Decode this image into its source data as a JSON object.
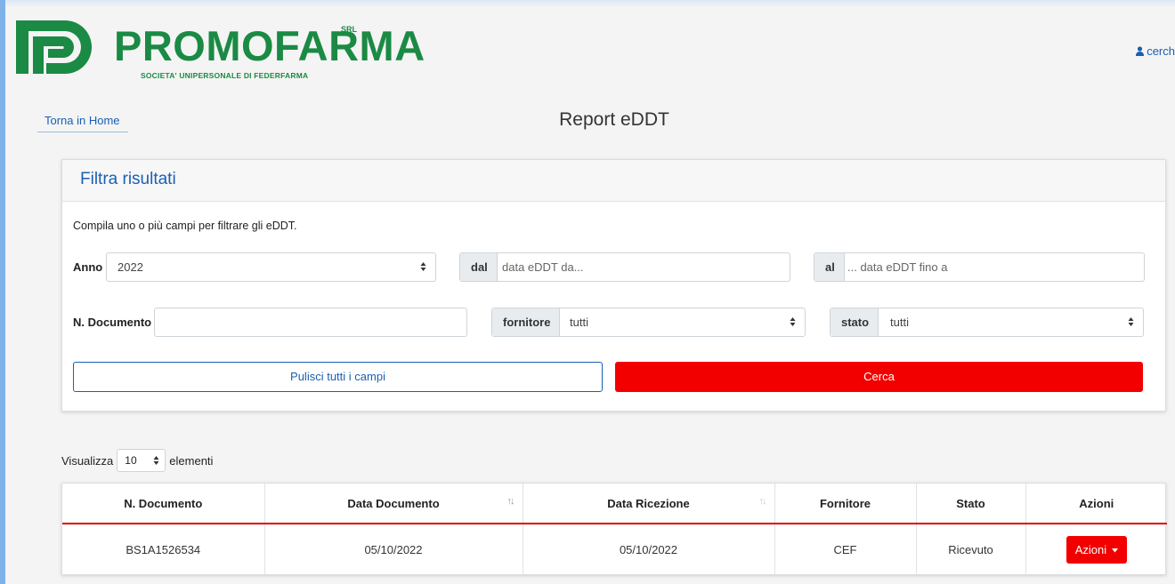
{
  "header": {
    "brand_name": "PROMOFARMA",
    "brand_suffix": "SRL",
    "brand_tagline": "SOCIETA' UNIPERSONALE DI FEDERFARMA",
    "user_link": "cerch",
    "brand_color": "#1a8a44"
  },
  "nav": {
    "home_link": "Torna in Home",
    "page_title": "Report eDDT"
  },
  "filter": {
    "title": "Filtra risultati",
    "hint": "Compila uno o più campi per filtrare gli eDDT.",
    "anno_label": "Anno",
    "anno_value": "2022",
    "dal_label": "dal",
    "dal_placeholder": "data eDDT da...",
    "al_label": "al",
    "al_placeholder": "... data eDDT fino a",
    "ndoc_label": "N. Documento",
    "ndoc_value": "",
    "fornitore_label": "fornitore",
    "fornitore_value": "tutti",
    "stato_label": "stato",
    "stato_value": "tutti",
    "clear_button": "Pulisci tutti i campi",
    "search_button": "Cerca"
  },
  "paging": {
    "prefix": "Visualizza",
    "value": "10",
    "suffix": "elementi"
  },
  "table": {
    "columns": [
      "N. Documento",
      "Data Documento",
      "Data Ricezione",
      "Fornitore",
      "Stato",
      "Azioni"
    ],
    "rows": [
      {
        "n_documento": "BS1A1526534",
        "data_documento": "05/10/2022",
        "data_ricezione": "05/10/2022",
        "fornitore": "CEF",
        "stato": "Ricevuto",
        "azioni": "Azioni"
      }
    ]
  },
  "colors": {
    "accent_red": "#f20000",
    "link_blue": "#1a5fb4"
  }
}
